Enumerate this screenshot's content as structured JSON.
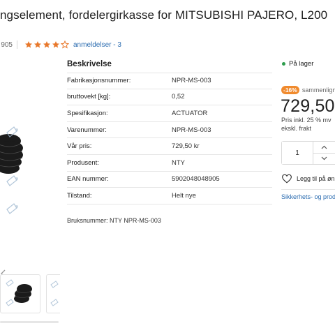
{
  "product": {
    "title": "ngselement, fordelergirkasse for MITSUBISHI PAJERO, L200",
    "code_fragment": "905",
    "rating": 4,
    "rating_max": 5,
    "reviews_link": "anmeldelser - 3"
  },
  "description": {
    "heading": "Beskrivelse",
    "rows": [
      {
        "key": "Fabrikasjonsnummer:",
        "value": "NPR-MS-003"
      },
      {
        "key": "bruttovekt [kg]:",
        "value": "0,52"
      },
      {
        "key": "Spesifikasjon:",
        "value": "ACTUATOR"
      },
      {
        "key": "Varenummer:",
        "value": "NPR-MS-003"
      },
      {
        "key": "Vår pris:",
        "value": "729,50 kr"
      },
      {
        "key": "Produsent:",
        "value": "NTY"
      },
      {
        "key": "EAN nummer:",
        "value": "5902048048905"
      },
      {
        "key": "Tilstand:",
        "value": "Helt nye"
      }
    ],
    "usage_note": "Bruksnummer: NTY NPR-MS-003"
  },
  "purchase": {
    "stock_status": "På lager",
    "discount_badge": "-16%",
    "compare_label": "sammenlign",
    "price": "729,50",
    "vat_note_line1": "Pris inkl. 25 % mv",
    "vat_note_line2": "ekskl. frakt",
    "quantity": "1",
    "wishlist_label": "Legg til på øn",
    "safety_link": "Sikkerhets- og prod"
  },
  "colors": {
    "accent_orange": "#f08a2d",
    "star": "#e8782b",
    "link": "#2b6cb0",
    "in_stock": "#2e9d4d"
  },
  "icons": {
    "up": "chevron-up-icon",
    "down": "chevron-down-icon",
    "wishlist": "heart-icon",
    "gallery_prev": "chevron-left-icon"
  }
}
